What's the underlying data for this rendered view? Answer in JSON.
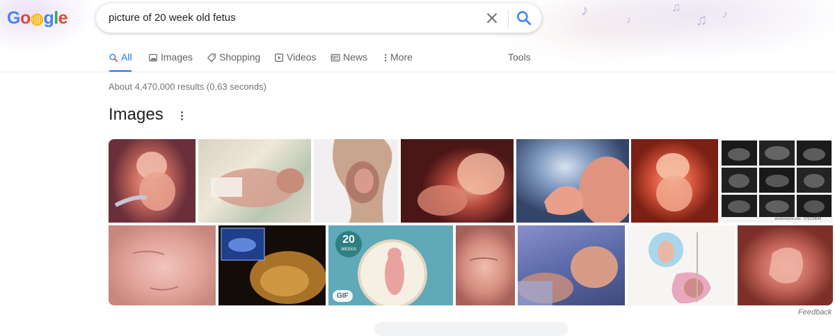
{
  "header": {
    "logo_letters": [
      {
        "ch": "G",
        "color": "#4285f4"
      },
      {
        "ch": "o",
        "color": "#ea4335"
      },
      {
        "ch": "◍",
        "color": "#fbbc05"
      },
      {
        "ch": "g",
        "color": "#4285f4"
      },
      {
        "ch": "l",
        "color": "#34a853"
      },
      {
        "ch": "e",
        "color": "#ea4335"
      }
    ],
    "search_query": "picture of 20 week old fetus"
  },
  "tabs": [
    {
      "label": "All",
      "icon": "search-icon",
      "active": true
    },
    {
      "label": "Images",
      "icon": "image-icon",
      "active": false
    },
    {
      "label": "Shopping",
      "icon": "tag-icon",
      "active": false
    },
    {
      "label": "Videos",
      "icon": "play-icon",
      "active": false
    },
    {
      "label": "News",
      "icon": "newspaper-icon",
      "active": false
    },
    {
      "label": "More",
      "icon": "vertical-dots-icon",
      "active": false
    }
  ],
  "tools_label": "Tools",
  "result_stats": "About 4,470,000 results (0.63 seconds)",
  "images_section": {
    "title": "Images",
    "gif_badge": "GIF",
    "weeks_number": "20",
    "weeks_word": "WEEKS",
    "shutterstock_caption": "shutterstock.com · 676229640",
    "feedback_label": "Feedback"
  },
  "colors": {
    "accent": "#1a73e8",
    "muted_text": "#70757a",
    "tab_text": "#5f6368"
  }
}
